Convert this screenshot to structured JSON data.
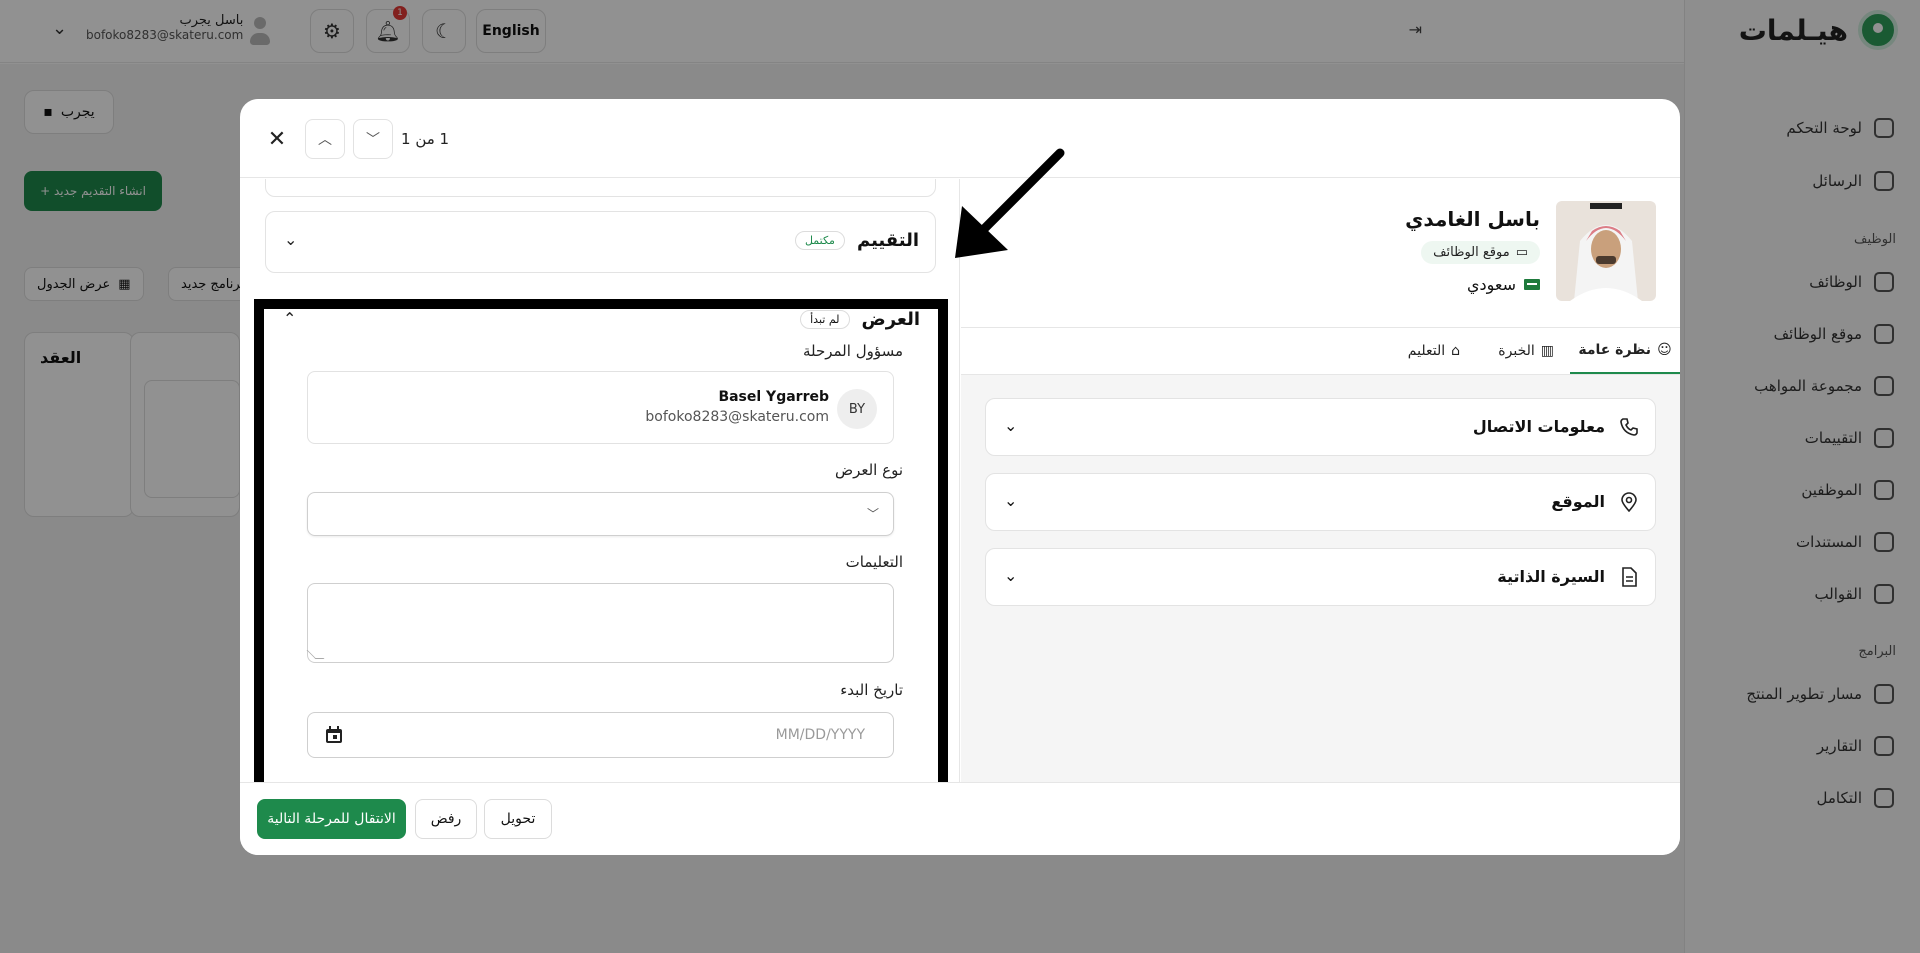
{
  "app": {
    "logo_text": "هيـلمات",
    "header": {
      "user_name": "باسل يجرب",
      "user_email": "bofoko8283@skateru.com",
      "language_button": "English",
      "notification_count": "1"
    },
    "sidebar": {
      "items": [
        {
          "label": "لوحة التحكم",
          "icon": "grid-icon"
        },
        {
          "label": "الرسائل",
          "icon": "mail-icon"
        }
      ],
      "section_jobs": "الوظيف",
      "job_items": [
        {
          "label": "الوظائف",
          "icon": "briefcase-icon"
        },
        {
          "label": "موقع الوظائف",
          "icon": "laptop-icon"
        },
        {
          "label": "مجموعة المواهب",
          "icon": "dollar-icon"
        },
        {
          "label": "التقييمات",
          "icon": "store-icon"
        },
        {
          "label": "الموظفين",
          "icon": "user-icon"
        },
        {
          "label": "المستندات",
          "icon": "document-icon"
        },
        {
          "label": "القوالب",
          "icon": "template-icon"
        }
      ],
      "section_programs": "البرامج",
      "program_items": [
        {
          "label": "مسار تطوير المنتج",
          "icon": "hand-icon"
        },
        {
          "label": "التقارير",
          "icon": "filter-icon"
        },
        {
          "label": "التكامل",
          "icon": "link-icon"
        }
      ]
    },
    "content": {
      "try_button": "يجرب",
      "create_button": "انشاء التقديم جديد",
      "view_table_button": "عرض الجدول",
      "new_program_button": "برنامج جديد",
      "column_title": "العقد"
    }
  },
  "modal": {
    "pager_text": "1 من 1",
    "evaluation_section": {
      "title": "التقييم",
      "status": "مكتمل"
    },
    "offer_section": {
      "title": "العرض",
      "status": "لم تبدأ",
      "owner_label": "مسؤول المرحلة",
      "owner": {
        "initials": "BY",
        "name": "Basel Ygarreb",
        "email": "bofoko8283@skateru.com"
      },
      "offer_type_label": "نوع العرض",
      "offer_type_value": "",
      "instructions_label": "التعليمات",
      "instructions_value": "",
      "start_date_label": "تاريخ البدء",
      "start_date_placeholder": "MM/DD/YYYY"
    },
    "candidate": {
      "name": "باسل الغامدي",
      "source": "موقع الوظائف",
      "nationality": "سعودي"
    },
    "tabs": [
      {
        "label": "نظرة عامة",
        "icon": "user-icon",
        "active": true
      },
      {
        "label": "الخبرة",
        "icon": "building-icon",
        "active": false
      },
      {
        "label": "التعليم",
        "icon": "graduation-cap-icon",
        "active": false
      }
    ],
    "info_cards": [
      {
        "title": "معلومات الاتصال",
        "icon": "phone-icon"
      },
      {
        "title": "الموقع",
        "icon": "location-pin-icon"
      },
      {
        "title": "السيرة الذاتية",
        "icon": "resume-icon"
      }
    ],
    "footer": {
      "next_stage_button": "الانتقال للمرحلة التالية",
      "reject_button": "رفض",
      "transfer_button": "تحويل"
    },
    "colors": {
      "primary": "#1e8a4c",
      "annotation": "#000000"
    }
  }
}
